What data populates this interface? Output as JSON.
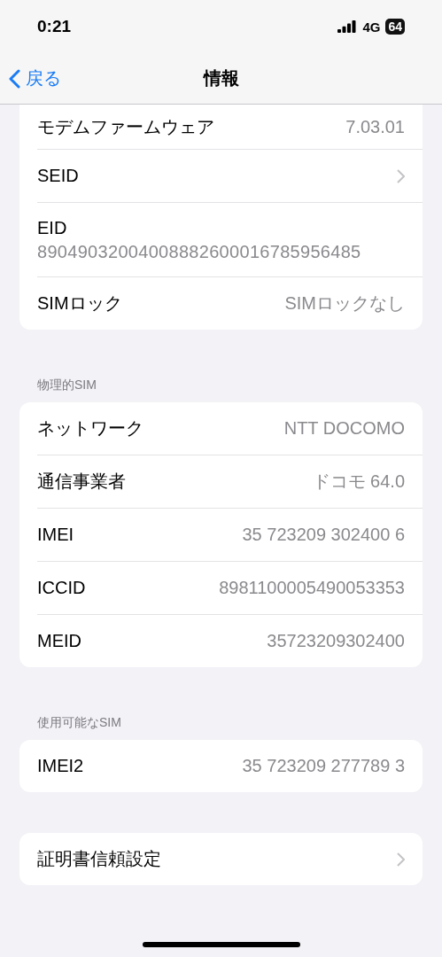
{
  "status_bar": {
    "time": "0:21",
    "network": "4G",
    "battery": "64"
  },
  "nav_bar": {
    "back": "戻る",
    "title": "情報"
  },
  "sections": [
    {
      "rows": [
        {
          "kind": "value",
          "label": "モデムファームウェア",
          "value": "7.03.01"
        },
        {
          "kind": "chevron",
          "label": "SEID"
        },
        {
          "kind": "stacked",
          "label": "EID",
          "value": "89049032004008882600016785956485"
        },
        {
          "kind": "value",
          "label": "SIMロック",
          "value": "SIMロックなし"
        }
      ]
    },
    {
      "header": "物理的SIM",
      "rows": [
        {
          "kind": "value",
          "label": "ネットワーク",
          "value": "NTT DOCOMO"
        },
        {
          "kind": "value",
          "label": "通信事業者",
          "value": "ドコモ 64.0"
        },
        {
          "kind": "value",
          "label": "IMEI",
          "value": "35 723209 302400 6"
        },
        {
          "kind": "value",
          "label": "ICCID",
          "value": "8981100005490053353"
        },
        {
          "kind": "value",
          "label": "MEID",
          "value": "35723209302400"
        }
      ]
    },
    {
      "header": "使用可能なSIM",
      "rows": [
        {
          "kind": "value",
          "label": "IMEI2",
          "value": "35 723209 277789 3"
        }
      ]
    },
    {
      "rows": [
        {
          "kind": "chevron",
          "label": "証明書信頼設定"
        }
      ]
    }
  ]
}
